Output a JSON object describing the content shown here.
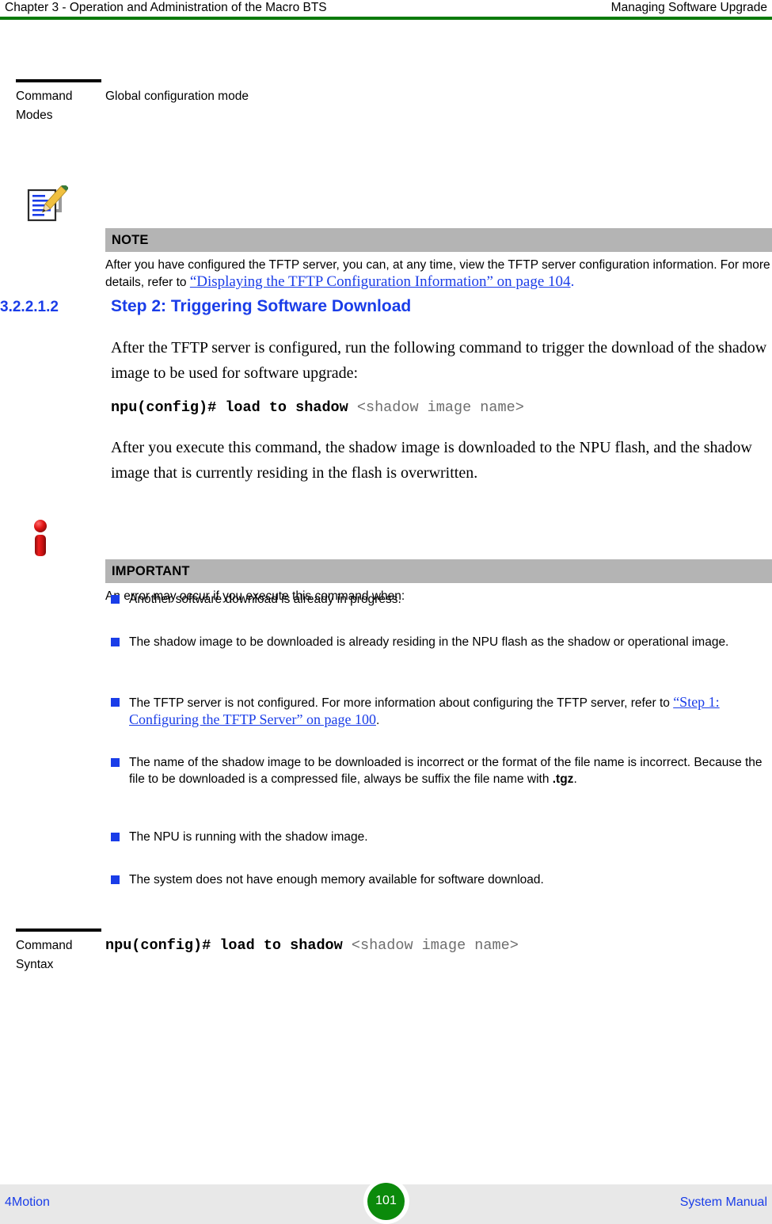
{
  "header": {
    "left": "Chapter 3 - Operation and Administration of the Macro BTS",
    "right": "Managing Software Upgrade",
    "rule_color": "#0b7a0b"
  },
  "command_modes": {
    "label_line1": "Command",
    "label_line2": "Modes",
    "value": "Global configuration mode"
  },
  "note": {
    "icon": "note-pencil-document-icon",
    "title": "NOTE",
    "text_before": "After you have configured the TFTP server, you can, at any time, view the TFTP server configuration information. For more details, refer to ",
    "link": "“Displaying the TFTP Configuration Information” on page 104",
    "text_after": ".",
    "bar_color": "#b4b4b4"
  },
  "section": {
    "number": "3.2.2.1.2",
    "title": "Step 2: Triggering Software Download",
    "color": "#1a3de8"
  },
  "paragraph1": "After the TFTP server is configured, run the following command to trigger the download of the shadow image to be used for software upgrade:",
  "code1": {
    "command": "npu(config)# load to shadow",
    "argument": "<shadow image name>"
  },
  "paragraph2": "After you execute this command, the shadow image is downloaded to the NPU flash, and the shadow image that is currently residing in the flash is overwritten.",
  "important": {
    "icon": "important-info-icon",
    "title": "IMPORTANT",
    "intro": "An error may occur if you execute this command when:",
    "bar_color": "#b4b4b4",
    "bullet_color": "#1a3de8",
    "bullets": [
      {
        "text": "Another software download is already in progress."
      },
      {
        "text": "The shadow image to be downloaded is already residing in the NPU flash as the shadow or operational image."
      },
      {
        "text_before": "The TFTP server is not configured. For more information about configuring the TFTP server, refer to ",
        "link": "“Step 1: Configuring the TFTP Server” on page 100",
        "text_after": "."
      },
      {
        "text_before": "The name of the shadow image to be downloaded is incorrect or the format of the file name is incorrect. Because the file to be downloaded is a compressed file, always be suffix the file name with ",
        "bold": ".tgz",
        "text_after": "."
      },
      {
        "text": "The NPU is running with the shadow image."
      },
      {
        "text": "The system does not have enough memory available for software download."
      }
    ]
  },
  "command_syntax": {
    "label_line1": "Command",
    "label_line2": "Syntax",
    "command": "npu(config)# load to shadow",
    "argument": "<shadow image name>"
  },
  "footer": {
    "left": "4Motion",
    "page": "101",
    "right": "System Manual",
    "page_bg": "#0b8a0b",
    "band_bg": "#e8e8e8",
    "text_color": "#1a3de8"
  }
}
